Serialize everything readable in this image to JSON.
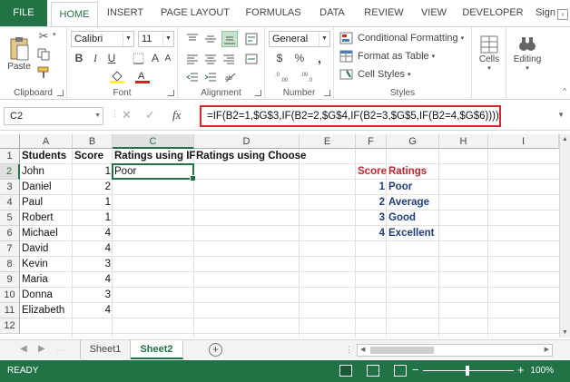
{
  "ribbon_tabs": [
    "FILE",
    "HOME",
    "INSERT",
    "PAGE LAYOUT",
    "FORMULAS",
    "DATA",
    "REVIEW",
    "VIEW",
    "DEVELOPER"
  ],
  "signin": "Sign",
  "groups": {
    "clipboard": {
      "label": "Clipboard",
      "paste": "Paste"
    },
    "font": {
      "label": "Font",
      "font_name": "Calibri",
      "font_size": "11"
    },
    "alignment": {
      "label": "Alignment"
    },
    "number": {
      "label": "Number",
      "format": "General",
      "currency": "$",
      "percent": "%",
      "comma": ","
    },
    "styles": {
      "label": "Styles",
      "conditional": "Conditional Formatting",
      "table": "Format as Table",
      "cell_styles": "Cell Styles"
    },
    "cells": {
      "label": "Cells"
    },
    "editing": {
      "label": "Editing"
    }
  },
  "formula_bar": {
    "name_box": "C2",
    "fx": "fx",
    "formula": "=IF(B2=1,$G$3,IF(B2=2,$G$4,IF(B2=3,$G$5,IF(B2=4,$G$6))))"
  },
  "columns": [
    "A",
    "B",
    "C",
    "D",
    "E",
    "F",
    "G",
    "H",
    "I"
  ],
  "rows": [
    "1",
    "2",
    "3",
    "4",
    "5",
    "6",
    "7",
    "8",
    "9",
    "10",
    "11",
    "12"
  ],
  "sheet": {
    "headers": {
      "a": "Students",
      "b": "Score",
      "c": "Ratings using IF",
      "d": "Ratings using Choose"
    },
    "students": [
      "John",
      "Daniel",
      "Paul",
      "Robert",
      "Michael",
      "David",
      "Kevin",
      "Maria",
      "Donna",
      "Elizabeth"
    ],
    "scores": [
      "1",
      "2",
      "1",
      "1",
      "4",
      "4",
      "3",
      "4",
      "3",
      "4"
    ],
    "c2": "Poor",
    "lookup": {
      "score_header": "Score",
      "ratings_header": "Ratings",
      "scores": [
        "1",
        "2",
        "3",
        "4"
      ],
      "ratings": [
        "Poor",
        "Average",
        "Good",
        "Excellent"
      ]
    }
  },
  "sheet_tabs": [
    "Sheet1",
    "Sheet2"
  ],
  "active_sheet": "Sheet2",
  "status": {
    "ready": "READY",
    "zoom": "100%"
  },
  "icons": [
    "cut-icon",
    "copy-icon",
    "format-painter-icon",
    "bold-icon",
    "italic-icon",
    "underline-icon",
    "borders-icon",
    "fill-color-icon",
    "font-color-icon",
    "align-icons",
    "wrap-text-icon",
    "merge-icon",
    "conditional-formatting-icon",
    "format-table-icon",
    "cell-styles-icon",
    "cells-icon",
    "editing-icon"
  ],
  "colors": {
    "accent": "#217346",
    "highlight": "#d9262d",
    "rating_red": "#c0272d",
    "rating_navy": "#1f3d7a"
  }
}
